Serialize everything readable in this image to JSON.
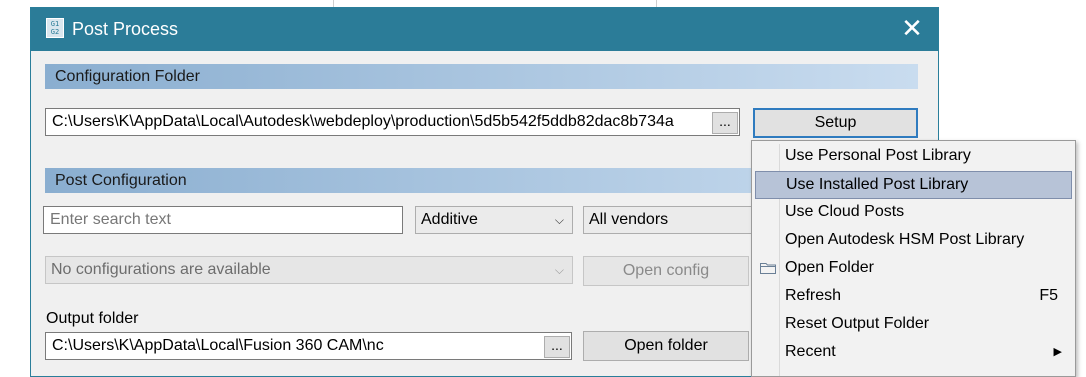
{
  "window": {
    "title": "Post Process",
    "icon_text": "G1 G2",
    "close_glyph": "✕"
  },
  "configuration_folder": {
    "header": "Configuration Folder",
    "path": "C:\\Users\\K\\AppData\\Local\\Autodesk\\webdeploy\\production\\5d5b542f5ddb82dac8b734a",
    "browse_label": "...",
    "setup_label": "Setup"
  },
  "post_configuration": {
    "header": "Post Configuration",
    "search_placeholder": "Enter search text",
    "category_value": "Additive",
    "vendor_value": "All vendors",
    "configs_value": "No configurations are available",
    "open_config_label": "Open config"
  },
  "output": {
    "label": "Output folder",
    "path": "C:\\Users\\K\\AppData\\Local\\Fusion 360 CAM\\nc",
    "browse_label": "...",
    "open_folder_label": "Open folder"
  },
  "setup_menu": {
    "items": [
      {
        "label": "Use Personal Post Library",
        "shortcut": "",
        "icon": "",
        "highlighted": false
      },
      {
        "label": "Use Installed Post Library",
        "shortcut": "",
        "icon": "",
        "highlighted": true
      },
      {
        "label": "Use Cloud Posts",
        "shortcut": "",
        "icon": "",
        "highlighted": false
      },
      {
        "label": "Open Autodesk HSM Post Library",
        "shortcut": "",
        "icon": "",
        "highlighted": false
      },
      {
        "label": "Open Folder",
        "shortcut": "",
        "icon": "folder-icon",
        "highlighted": false
      },
      {
        "label": "Refresh",
        "shortcut": "F5",
        "icon": "",
        "highlighted": false
      },
      {
        "label": "Reset Output Folder",
        "shortcut": "",
        "icon": "",
        "highlighted": false
      },
      {
        "label": "Recent",
        "shortcut": "",
        "icon": "submenu-arrow-icon",
        "highlighted": false
      }
    ],
    "submenu_arrow": "▶"
  },
  "icons": {
    "chevron": "⌵"
  },
  "colors": {
    "titlebar": "#2b7c98",
    "dialog_bg": "#f0f0f0",
    "menu_highlight": "#b7c3d7",
    "default_button_border": "#2f7bbf"
  }
}
